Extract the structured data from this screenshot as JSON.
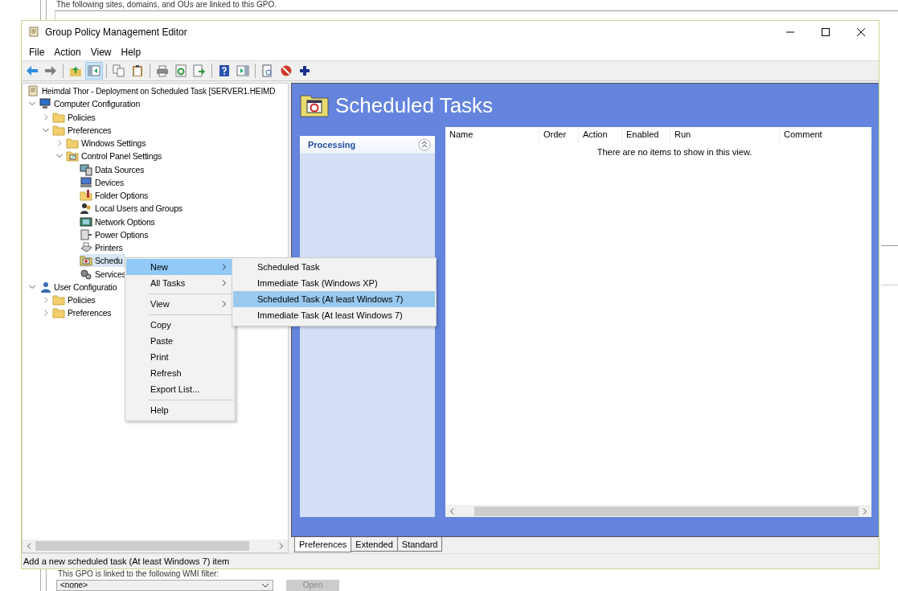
{
  "background_window": {
    "description": "The following sites, domains, and OUs are linked to this GPO.",
    "wmi_label": "This GPO is linked to the following WMI filter:",
    "wmi_filter": {
      "value": "<none>"
    },
    "open_button": {
      "label": "Open",
      "disabled": true
    }
  },
  "window": {
    "title": "Group Policy Management Editor"
  },
  "menu_bar": [
    "File",
    "Action",
    "View",
    "Help"
  ],
  "toolbar": [
    {
      "kind": "back",
      "pressed": false
    },
    {
      "kind": "forward",
      "pressed": false
    },
    {
      "kind": "separator"
    },
    {
      "kind": "up",
      "pressed": false
    },
    {
      "kind": "tree",
      "pressed": true
    },
    {
      "kind": "separator"
    },
    {
      "kind": "copy",
      "pressed": false
    },
    {
      "kind": "paste",
      "pressed": false
    },
    {
      "kind": "separator"
    },
    {
      "kind": "print",
      "pressed": false
    },
    {
      "kind": "refresh",
      "pressed": false
    },
    {
      "kind": "export",
      "pressed": false
    },
    {
      "kind": "separator"
    },
    {
      "kind": "help",
      "pressed": false
    },
    {
      "kind": "pane",
      "pressed": false
    },
    {
      "kind": "separator"
    },
    {
      "kind": "document",
      "pressed": false
    },
    {
      "kind": "stop",
      "pressed": false
    },
    {
      "kind": "add",
      "pressed": false
    }
  ],
  "tree": [
    {
      "label": "Heimdal Thor - Deployment on Scheduled Task [SERVER1.HEIMD",
      "kind": "document",
      "selected": false,
      "children": [
        {
          "label": "Computer Configuration",
          "kind": "computer",
          "expanded": true,
          "selected": false,
          "children": [
            {
              "label": "Policies",
              "kind": "folder",
              "expanded": false,
              "selected": false
            },
            {
              "label": "Preferences",
              "kind": "folder",
              "expanded": true,
              "selected": false,
              "children": [
                {
                  "label": "Windows Settings",
                  "kind": "folder",
                  "expanded": false,
                  "selected": false
                },
                {
                  "label": "Control Panel Settings",
                  "kind": "control-panel",
                  "expanded": true,
                  "selected": false,
                  "children": [
                    {
                      "label": "Data Sources",
                      "kind": "database",
                      "selected": false
                    },
                    {
                      "label": "Devices",
                      "kind": "monitor",
                      "selected": false
                    },
                    {
                      "label": "Folder Options",
                      "kind": "folder-options",
                      "selected": false
                    },
                    {
                      "label": "Local Users and Groups",
                      "kind": "users",
                      "selected": false
                    },
                    {
                      "label": "Network Options",
                      "kind": "network",
                      "selected": false
                    },
                    {
                      "label": "Power Options",
                      "kind": "power",
                      "selected": false
                    },
                    {
                      "label": "Printers",
                      "kind": "printer",
                      "selected": false
                    },
                    {
                      "label": "Schedu",
                      "kind": "scheduled",
                      "selected": true
                    },
                    {
                      "label": "Services",
                      "kind": "gears",
                      "selected": false
                    }
                  ]
                }
              ]
            }
          ]
        },
        {
          "label": "User Configuratio",
          "kind": "user",
          "expanded": true,
          "selected": false,
          "children": [
            {
              "label": "Policies",
              "kind": "folder",
              "expanded": false,
              "selected": false
            },
            {
              "label": "Preferences",
              "kind": "folder",
              "expanded": false,
              "selected": false
            }
          ]
        }
      ]
    }
  ],
  "details": {
    "title": "Scheduled Tasks",
    "side_panel": {
      "title": "Processing",
      "expanded": true
    },
    "columns": [
      "Name",
      "Order",
      "Action",
      "Enabled",
      "Run",
      "Comment"
    ],
    "empty_message": "There are no items to show in this view."
  },
  "bottom_tabs": [
    {
      "label": "Preferences",
      "selected": true
    },
    {
      "label": "Extended",
      "selected": false
    },
    {
      "label": "Standard",
      "selected": false
    }
  ],
  "status_bar": "Add a new scheduled task (At least Windows 7) item",
  "context_menu": [
    {
      "kind": "item",
      "label": "New",
      "submenu": true,
      "selected": true
    },
    {
      "kind": "item",
      "label": "All Tasks",
      "submenu": true,
      "selected": false
    },
    {
      "kind": "separator"
    },
    {
      "kind": "item",
      "label": "View",
      "submenu": true,
      "selected": false
    },
    {
      "kind": "separator"
    },
    {
      "kind": "item",
      "label": "Copy",
      "submenu": false,
      "selected": false
    },
    {
      "kind": "item",
      "label": "Paste",
      "submenu": false,
      "selected": false
    },
    {
      "kind": "item",
      "label": "Print",
      "submenu": false,
      "selected": false
    },
    {
      "kind": "item",
      "label": "Refresh",
      "submenu": false,
      "selected": false
    },
    {
      "kind": "item",
      "label": "Export List...",
      "submenu": false,
      "selected": false
    },
    {
      "kind": "separator"
    },
    {
      "kind": "item",
      "label": "Help",
      "submenu": false,
      "selected": false
    }
  ],
  "submenu": [
    {
      "label": "Scheduled Task",
      "selected": false
    },
    {
      "label": "Immediate Task (Windows XP)",
      "selected": false
    },
    {
      "label": "Scheduled Task (At least Windows 7)",
      "selected": true
    },
    {
      "label": "Immediate Task (At least Windows 7)",
      "selected": false
    }
  ]
}
